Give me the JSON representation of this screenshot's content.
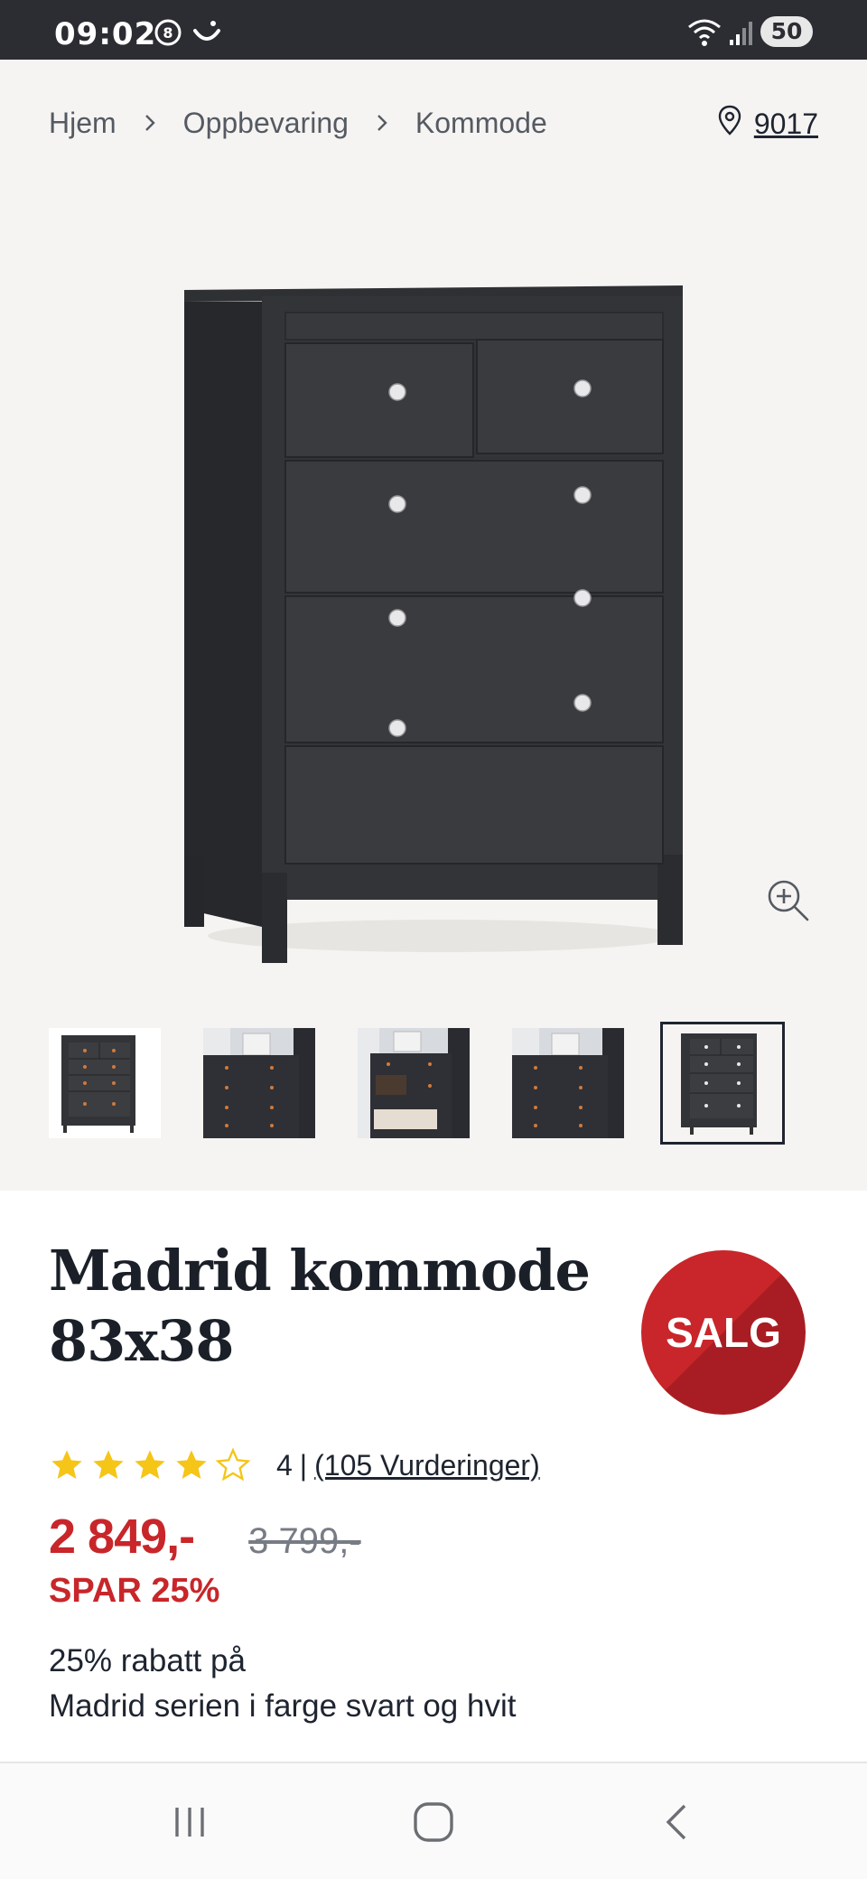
{
  "status_bar": {
    "time": "09:02",
    "battery": "50"
  },
  "breadcrumb": {
    "items": [
      "Hjem",
      "Oppbevaring",
      "Kommode"
    ],
    "separator": ">"
  },
  "location": {
    "zip": "9017",
    "icon": "location-pin-icon"
  },
  "gallery": {
    "thumbnail_count": 5,
    "active_index": 4
  },
  "product": {
    "title_line1": "Madrid kommode",
    "title_line2": "83x38",
    "badge": "SALG",
    "rating": {
      "stars": 4,
      "max_stars": 5,
      "score": "4",
      "divider": "|",
      "reviews": "(105 Vurderinger)"
    },
    "price": "2 849,-",
    "old_price": "3 799,-",
    "save_text": "SPAR 25%",
    "promo_line1": "25% rabatt på",
    "promo_line2": "Madrid serien i farge svart og hvit"
  },
  "colors": {
    "brand_red": "#c8262a",
    "star_yellow": "#f5c518",
    "text_dark": "#1e2430",
    "media_bg": "#f5f4f2"
  }
}
